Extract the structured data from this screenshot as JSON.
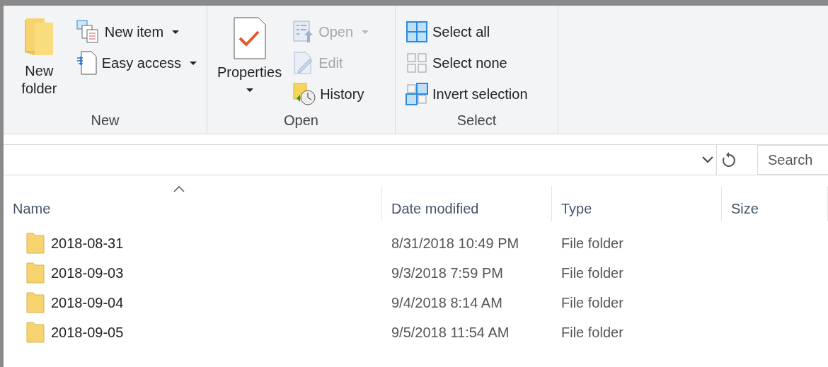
{
  "ribbon": {
    "groups": [
      {
        "label": "New",
        "items": [
          {
            "kind": "large",
            "label": "New folder",
            "disabled": false,
            "has_menu": false
          },
          {
            "kind": "small",
            "label": "New item",
            "disabled": false,
            "has_menu": true
          },
          {
            "kind": "small",
            "label": "Easy access",
            "disabled": false,
            "has_menu": true
          }
        ]
      },
      {
        "label": "Open",
        "items": [
          {
            "kind": "large",
            "label": "Properties",
            "disabled": false,
            "has_menu": true
          },
          {
            "kind": "small",
            "label": "Open",
            "disabled": true,
            "has_menu": true
          },
          {
            "kind": "small",
            "label": "Edit",
            "disabled": true,
            "has_menu": false
          },
          {
            "kind": "small",
            "label": "History",
            "disabled": false,
            "has_menu": false
          }
        ]
      },
      {
        "label": "Select",
        "items": [
          {
            "kind": "small",
            "label": "Select all",
            "disabled": false,
            "has_menu": false
          },
          {
            "kind": "small",
            "label": "Select none",
            "disabled": false,
            "has_menu": false
          },
          {
            "kind": "small",
            "label": "Invert selection",
            "disabled": false,
            "has_menu": false
          }
        ]
      }
    ]
  },
  "search": {
    "placeholder": "Search"
  },
  "table": {
    "columns": [
      {
        "label": "Name",
        "sorted": true
      },
      {
        "label": "Date modified",
        "sorted": false
      },
      {
        "label": "Type",
        "sorted": false
      },
      {
        "label": "Size",
        "sorted": false
      }
    ],
    "rows": [
      {
        "name": "2018-08-31",
        "date": "8/31/2018 10:49 PM",
        "type": "File folder"
      },
      {
        "name": "2018-09-03",
        "date": "9/3/2018 7:59 PM",
        "type": "File folder"
      },
      {
        "name": "2018-09-04",
        "date": "9/4/2018 8:14 AM",
        "type": "File folder"
      },
      {
        "name": "2018-09-05",
        "date": "9/5/2018 11:54 AM",
        "type": "File folder"
      }
    ]
  }
}
